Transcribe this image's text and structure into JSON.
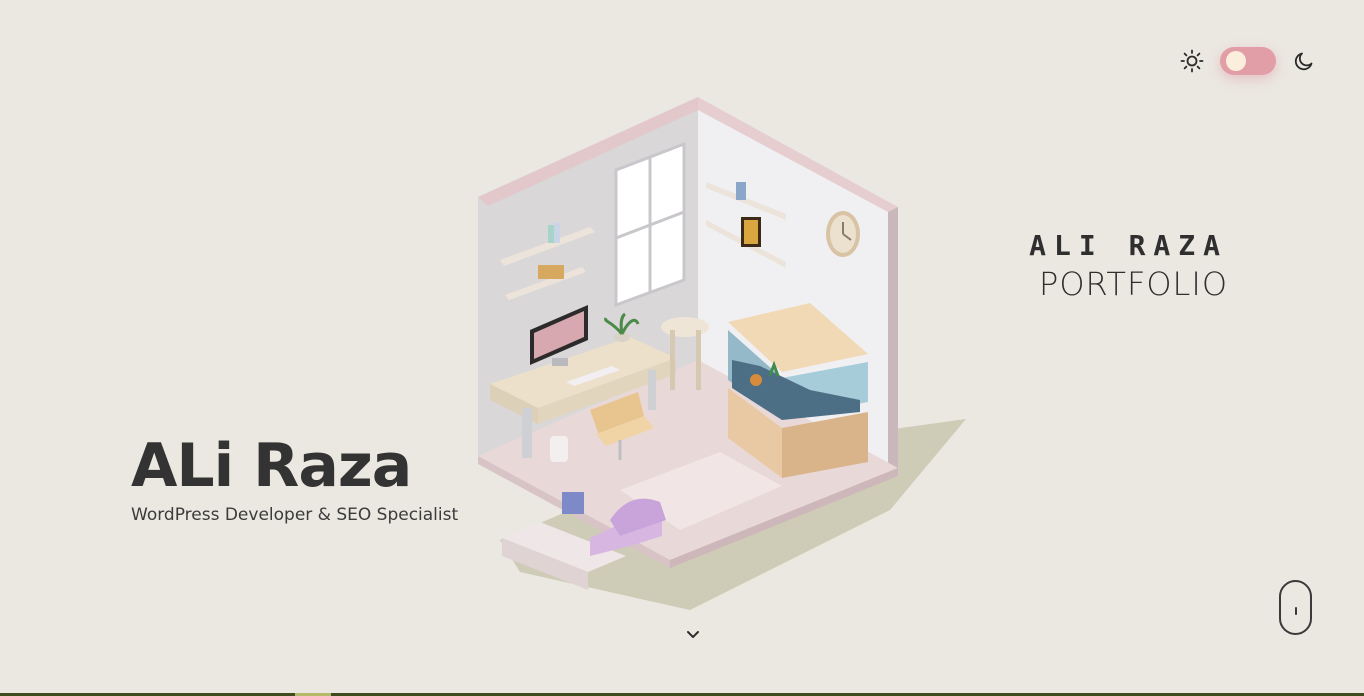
{
  "theme": {
    "sun_icon": "sun-icon",
    "moon_icon": "moon-icon",
    "toggle_color": "#e29ea7",
    "toggle_knob_color": "#fbeedc",
    "mode": "light"
  },
  "title": {
    "line1": "ALI RAZA",
    "line2": "PORTFOLIO"
  },
  "hero": {
    "name": "ALi Raza",
    "subtitle": "WordPress Developer & SEO Specialist"
  },
  "scroll": {
    "chevron_icon": "chevron-down-icon",
    "mouse_icon": "mouse-scroll-icon"
  },
  "colors": {
    "background": "#ebe8e1",
    "text": "#333333",
    "accent": "#e29ea7"
  }
}
